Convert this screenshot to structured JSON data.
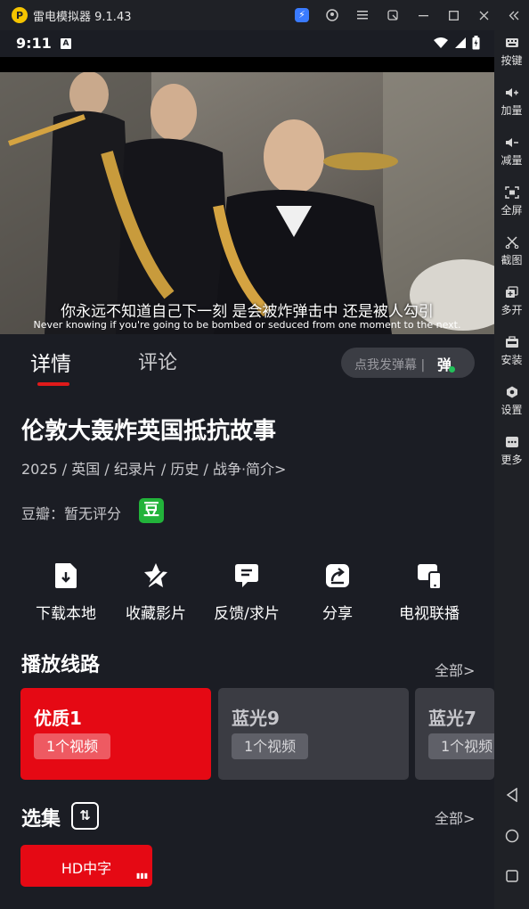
{
  "emulator": {
    "title": "雷电模拟器 9.1.43",
    "logo_text": "P",
    "titlebar_icons": [
      "sync-icon",
      "account-icon",
      "menu-icon",
      "popout-icon",
      "minimize-icon",
      "maximize-icon",
      "close-icon",
      "collapse-icon"
    ],
    "sidebar": [
      {
        "label": "按键",
        "icon": "keyboard-icon"
      },
      {
        "label": "加量",
        "icon": "volume-up-icon"
      },
      {
        "label": "减量",
        "icon": "volume-down-icon"
      },
      {
        "label": "全屏",
        "icon": "fullscreen-icon"
      },
      {
        "label": "截图",
        "icon": "screenshot-icon"
      },
      {
        "label": "多开",
        "icon": "multi-instance-icon"
      },
      {
        "label": "安装",
        "icon": "apk-install-icon"
      },
      {
        "label": "设置",
        "icon": "settings-icon"
      },
      {
        "label": "更多",
        "icon": "more-icon"
      }
    ],
    "android_nav": [
      "back-icon",
      "home-icon",
      "recents-icon"
    ]
  },
  "status_bar": {
    "time": "9:11",
    "notif": "A"
  },
  "video": {
    "subtitle_cn": "你永远不知道自己下一刻 是会被炸弹击中 还是被人勾引",
    "subtitle_en": "Never knowing if you're going to be bombed or seduced from one moment to the next."
  },
  "tabs": [
    {
      "label": "详情",
      "active": true
    },
    {
      "label": "评论",
      "active": false
    }
  ],
  "danmu": {
    "placeholder": "点我发弹幕 |",
    "icon_text": "弹"
  },
  "detail": {
    "title": "伦敦大轰炸英国抵抗故事",
    "meta": "2025 / 英国 / 纪录片 / 历史 / 战争·简介>",
    "douban": "豆瓣：暂无评分",
    "douban_badge": "豆"
  },
  "actions": [
    {
      "label": "下载本地",
      "icon": "download-icon"
    },
    {
      "label": "收藏影片",
      "icon": "favorite-icon"
    },
    {
      "label": "反馈/求片",
      "icon": "feedback-icon"
    },
    {
      "label": "分享",
      "icon": "share-icon"
    },
    {
      "label": "电视联播",
      "icon": "tv-cast-icon"
    }
  ],
  "routes_section": {
    "title": "播放线路",
    "more": "全部>",
    "routes": [
      {
        "name": "优质1",
        "count": "1个视频",
        "selected": true
      },
      {
        "name": "蓝光9",
        "count": "1个视频",
        "selected": false
      },
      {
        "name": "蓝光7",
        "count": "1个视频",
        "selected": false
      }
    ]
  },
  "episodes_section": {
    "title": "选集",
    "more": "全部>",
    "episodes": [
      {
        "label": "HD中字",
        "selected": true
      }
    ]
  },
  "colors": {
    "accent": "#e50914",
    "background": "#1b1d24",
    "card": "#3b3c43",
    "douban_green": "#22b33a"
  }
}
